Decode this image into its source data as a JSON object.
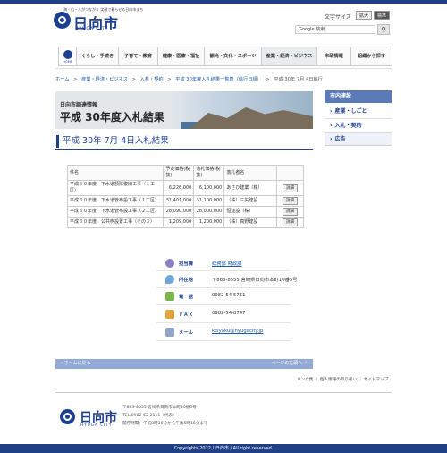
{
  "header": {
    "tagline": "海・山・人がつながり 笑顔で暮らせる日向市まち",
    "logo_name": "日向市",
    "logo_en": "HYUGA CITY",
    "font_size_label": "文字サイズ",
    "font_size_large": "拡大",
    "font_size_standard": "標準",
    "search_brand": "Google",
    "search_placeholder": "検索"
  },
  "nav": {
    "home_label": "HOME",
    "items": [
      {
        "label": "くらし・手続き"
      },
      {
        "label": "子育て・教育"
      },
      {
        "label": "健康・医療・福祉"
      },
      {
        "label": "観光・文化・スポーツ"
      },
      {
        "label": "産業・経済・ビジネス"
      },
      {
        "label": "市政情報"
      },
      {
        "label": "組織から探す"
      }
    ]
  },
  "breadcrumb": [
    "ホーム",
    ">",
    "産業・経済・ビジネス",
    ">",
    "入札・契約",
    ">",
    "平成 30年度入札結果一覧表（執行日順）",
    ">",
    "平成 30年 7月 4日執行"
  ],
  "banner": {
    "subtitle": "日向市調達情報",
    "title": "平成 30年度入札結果"
  },
  "page_title": "平成 30年 7月 4日入札結果",
  "table": {
    "headers": [
      "件名",
      "予定価格(税抜)",
      "落札価格(税抜)",
      "落札者名",
      ""
    ],
    "rows": [
      {
        "name": "平成３０年度　下水道額除復旧工事（１工区）",
        "planned": "6,226,000",
        "won": "6,100,000",
        "winner": "あさひ建業（株）",
        "btn": "詳細"
      },
      {
        "name": "平成３０年度　下水道管布設工事（１工区）",
        "planned": "31,401,000",
        "won": "31,100,000",
        "winner": "（株）三矢建設",
        "btn": "詳細"
      },
      {
        "name": "平成３０年度　下水道管布設工事（２工区）",
        "planned": "28,090,000",
        "won": "28,000,000",
        "winner": "恒建設（株）",
        "btn": "詳細"
      },
      {
        "name": "平成３０年度　公共桝設置工事（その３）",
        "planned": "1,209,000",
        "won": "1,200,000",
        "winner": "（株）真野建設",
        "btn": "詳細"
      }
    ]
  },
  "contact": {
    "dept_label": "担当課",
    "dept_value": "総務部 財政課",
    "addr_label": "所在地",
    "addr_value": "〒883-8555 宮崎県日向市本町10番5号",
    "tel_label": "電　話",
    "tel_value": "0982-54-5761",
    "fax_label": "ＦＡＸ",
    "fax_value": "0982-54-8747",
    "mail_label": "メール",
    "mail_value": "keiyaku@hyugacity.jp"
  },
  "sidebar": {
    "title": "市内建設",
    "items": [
      {
        "label": "産業・しごと"
      },
      {
        "label": "入札・契約"
      }
    ],
    "banner": "広告"
  },
  "bottom_bar": {
    "home": "ホームに戻る",
    "top": "ページの先頭へ"
  },
  "footer_links": "リンク集 ｜ 個人情報の取り扱い ｜ サイトマップ",
  "footer": {
    "name": "日向市",
    "en": "HYUGA CITY",
    "addr1": "〒883-8555 宮崎県日向市本町10番5号",
    "addr2": "TEL.0982-52-2111（代表）",
    "addr3": "開庁時間：午前8時30分から午後5時15分まで"
  },
  "copyright": "Copyrights 2022 / 日向市 / All right reserved."
}
